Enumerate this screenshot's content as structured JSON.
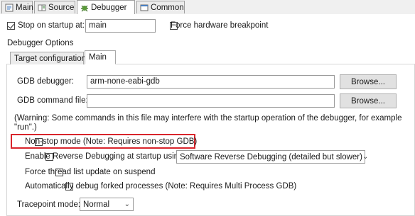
{
  "tabs": [
    {
      "label": "Main",
      "icon": "main-tab-icon"
    },
    {
      "label": "Source",
      "icon": "source-tab-icon"
    },
    {
      "label": "Debugger",
      "icon": "debugger-tab-icon",
      "selected": true
    },
    {
      "label": "Common",
      "icon": "common-tab-icon"
    }
  ],
  "stop_on_startup": {
    "label": "Stop on startup at:",
    "checked": true,
    "value": "main"
  },
  "force_hw_bp": {
    "label": "Force hardware breakpoint",
    "checked": false
  },
  "debugger_options": {
    "title": "Debugger Options",
    "subtabs": [
      {
        "label": "Target configuration"
      },
      {
        "label": "Main",
        "selected": true
      }
    ],
    "gdb_debugger": {
      "label": "GDB debugger:",
      "value": "arm-none-eabi-gdb",
      "browse": "Browse..."
    },
    "gdb_command_file": {
      "label": "GDB command file:",
      "value": "",
      "browse": "Browse..."
    },
    "warning_line1": "(Warning: Some commands in this file may interfere with the startup operation of the debugger, for example",
    "warning_line2": "\"run\".)",
    "non_stop": {
      "label": "Non-stop mode (Note: Requires non-stop GDB)",
      "checked": false
    },
    "reverse_debug": {
      "label": "Enable Reverse Debugging at startup using:",
      "checked": false,
      "select": "Software Reverse Debugging (detailed but slower)"
    },
    "force_thread": {
      "label": "Force thread list update on suspend",
      "checked": false
    },
    "auto_fork": {
      "label": "Automatically debug forked processes (Note: Requires Multi Process GDB)",
      "checked": false
    },
    "tracepoint": {
      "label": "Tracepoint mode:",
      "value": "Normal"
    }
  },
  "colors": {
    "highlight_border": "#d9252c",
    "tab_strip": "#f0f0f0"
  }
}
